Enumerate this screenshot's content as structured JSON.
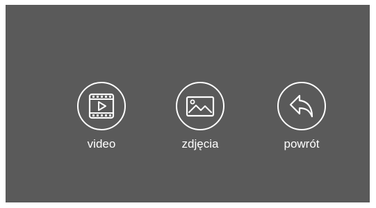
{
  "menu": {
    "items": [
      {
        "label": "video",
        "icon": "video-icon"
      },
      {
        "label": "zdjęcia",
        "icon": "photo-icon"
      },
      {
        "label": "powrót",
        "icon": "back-arrow-icon"
      }
    ]
  },
  "colors": {
    "background": "#5a5a5a",
    "foreground": "#ffffff"
  }
}
